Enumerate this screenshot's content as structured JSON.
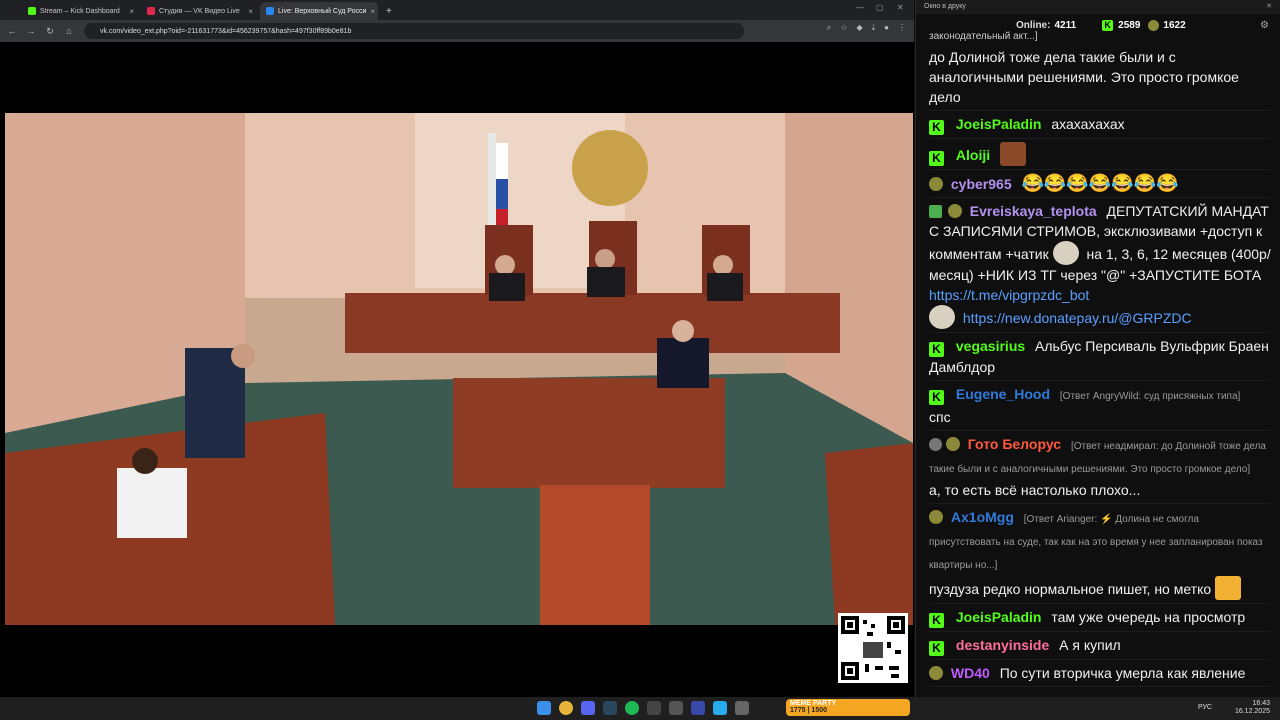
{
  "browser": {
    "tabs": [
      {
        "label": "Stream – Kick Dashboard",
        "favicon_color": "#53fc18"
      },
      {
        "label": "Студия — VK Видео Live",
        "favicon_color": "#e0284f"
      },
      {
        "label": "Live: Верховный Суд Росси",
        "favicon_color": "#2787f5"
      }
    ],
    "new_tab": "+",
    "url": "vk.com/video_ext.php?oid=-211631773&id=456239757&hash=497f30ff89b0e81b"
  },
  "chat": {
    "window_title": "Окно в друку",
    "online_label": "Online:",
    "online_count": "4211",
    "kick_count": "2589",
    "points_count": "1622",
    "messages": [
      {
        "user": "",
        "text": "законодательный акт...]",
        "reply": ""
      },
      {
        "user": "",
        "text": "до Долиной тоже дела такие были и с аналогичными решениями. Это просто громкое дело"
      },
      {
        "user": "JoeisPaladin",
        "text": "ахахахахах",
        "color": "#53fc18"
      },
      {
        "user": "Aloiji",
        "text": "",
        "color": "#53fc18"
      },
      {
        "user": "cyber965",
        "text": "😂😂😂😂😂😂😂",
        "color": "#b392f0"
      },
      {
        "user": "Evreiskaya_teplota",
        "text": "ДЕПУТАТСКИЙ МАНДАТ С ЗАПИСЯМИ СТРИМОВ, эксклюзивами +доступ к комментам +чатик",
        "text2": "на 1, 3, 6, 12 месяцев (400р/месяц) +НИК ИЗ ТГ через \"@\" +ЗАПУСТИТЕ БОТА",
        "link1": "https://t.me/vipgrpzdc_bot",
        "link2": "https://new.donatepay.ru/@GRPZDC",
        "color": "#b392f0"
      },
      {
        "user": "vegasirius",
        "text": "Альбус Персиваль Вульфрик Браен Дамблдор",
        "color": "#53fc18"
      },
      {
        "user": "Eugene_Hood",
        "reply": "[Ответ AngryWild: суд присяжных типа]",
        "text": "спс",
        "color": "#2f7bdc"
      },
      {
        "user": "Гото Белорус",
        "reply": "[Ответ неадмирал: до Долиной тоже дела такие были и с аналогичными решениями. Это просто громкое дело]",
        "text": "а, то есть всё настолько плохо...",
        "color": "#ff5a3c"
      },
      {
        "user": "Ax1oMgg",
        "reply": "[Ответ Arianger: ⚡ Долина не смогла присутствовать на суде, так как на это время у нее запланирован показ квартиры но...]",
        "text": "пуздуза редко нормальное пишет, но метко",
        "color": "#2f7bdc"
      },
      {
        "user": "JoeisPaladin",
        "text": "там уже очередь на просмотр",
        "color": "#53fc18"
      },
      {
        "user": "destanyinside",
        "text": "А я купил",
        "color": "#ff6f9c"
      },
      {
        "user": "WD40",
        "text": "По сути вторичка умерла как явление",
        "color": "#c05cff"
      }
    ]
  },
  "taskbar": {
    "widget": "MEME PARTY",
    "widget_stat": "1775 | 1500",
    "lang": "РУС",
    "time": "16:43",
    "date": "16.12.2025"
  }
}
